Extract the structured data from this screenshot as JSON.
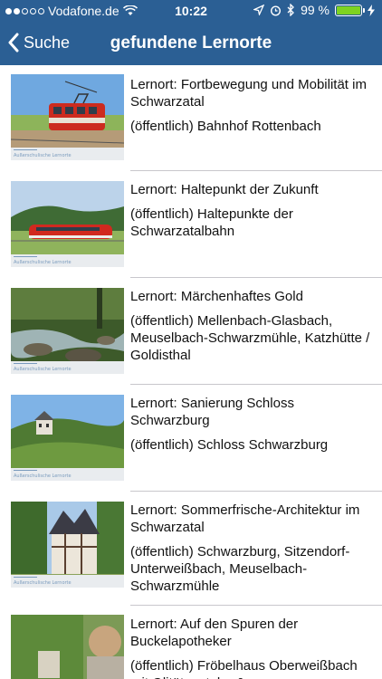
{
  "status_bar": {
    "carrier": "Vodafone.de",
    "time": "10:22",
    "battery": "99 %",
    "battery_level": 0.99,
    "wifi_icon": "wifi-icon",
    "location_icon": "location-arrow-icon",
    "alarm_icon": "alarm-icon",
    "bluetooth_icon": "bluetooth-icon"
  },
  "nav": {
    "back_label": "Suche",
    "title": "gefundene Lernorte",
    "bar_color": "#2b5f94"
  },
  "thumbnail_caption": "Außerschulische Lernorte",
  "items": [
    {
      "title": "Lernort: Fortbewegung und Mobilität im Schwarzatal",
      "place": "(öffentlich) Bahnhof Rottenbach"
    },
    {
      "title": "Lernort: Haltepunkt der Zukunft",
      "place": "(öffentlich) Haltepunkte der Schwarzatalbahn"
    },
    {
      "title": "Lernort: Märchenhaftes Gold",
      "place": "(öffentlich) Mellenbach-Glasbach, Meuselbach-Schwarzmühle, Katzhütte / Goldisthal"
    },
    {
      "title": "Lernort: Sanierung Schloss Schwarzburg",
      "place": "(öffentlich) Schloss Schwarzburg"
    },
    {
      "title": "Lernort: Sommerfrische-Architektur im Schwarzatal",
      "place": "(öffentlich) Schwarzburg, Sitzendorf-Unterweißbach, Meuselbach-Schwarzmühle"
    },
    {
      "title": "Lernort: Auf den Spuren der Buckelapotheker",
      "place": "(öffentlich) Fröbelhaus Oberweißbach mit Olitätenstube &"
    }
  ]
}
